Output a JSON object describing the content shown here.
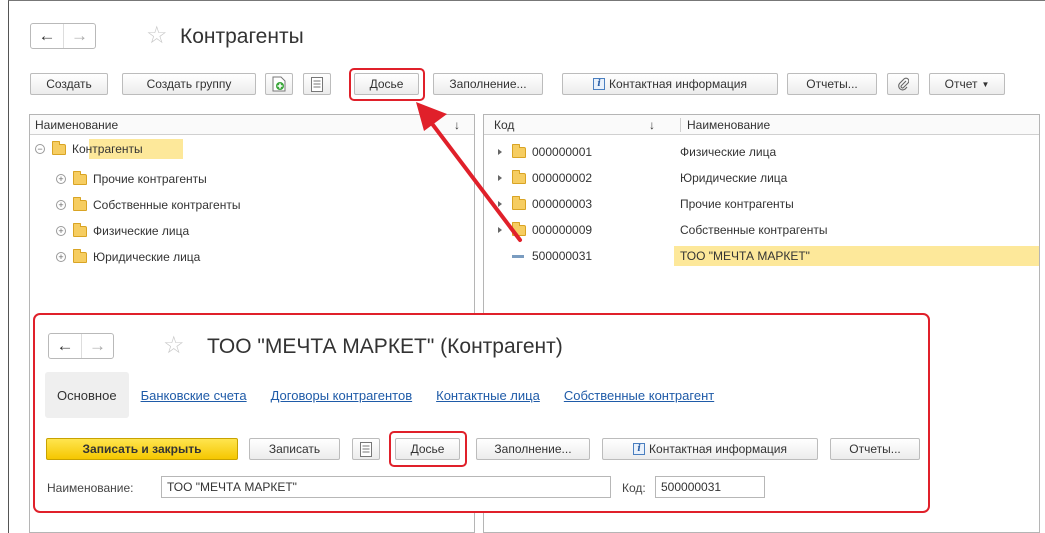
{
  "main": {
    "title": "Контрагенты",
    "toolbar": {
      "create": "Создать",
      "create_group": "Создать группу",
      "dossier": "Досье",
      "fill": "Заполнение...",
      "contact_info": "Контактная информация",
      "reports": "Отчеты...",
      "report": "Отчет"
    },
    "tree": {
      "column": "Наименование",
      "root": "Контрагенты",
      "items": [
        "Прочие контрагенты",
        "Собственные контрагенты",
        "Физические лица",
        "Юридические лица"
      ]
    },
    "list": {
      "col_code": "Код",
      "col_name": "Наименование",
      "rows": [
        {
          "code": "000000001",
          "name": "Физические лица",
          "type": "folder"
        },
        {
          "code": "000000002",
          "name": "Юридические лица",
          "type": "folder"
        },
        {
          "code": "000000003",
          "name": "Прочие контрагенты",
          "type": "folder"
        },
        {
          "code": "000000009",
          "name": "Собственные контрагенты",
          "type": "folder"
        },
        {
          "code": "500000031",
          "name": "ТОО \"МЕЧТА МАРКЕТ\"",
          "type": "item"
        }
      ]
    }
  },
  "sub": {
    "title": "ТОО \"МЕЧТА МАРКЕТ\" (Контрагент)",
    "tabs": [
      "Основное",
      "Банковские счета",
      "Договоры контрагентов",
      "Контактные лица",
      "Собственные контрагент"
    ],
    "toolbar": {
      "save_close": "Записать и закрыть",
      "save": "Записать",
      "dossier": "Досье",
      "fill": "Заполнение...",
      "contact_info": "Контактная информация",
      "reports": "Отчеты..."
    },
    "name_label": "Наименование:",
    "name_value": "ТОО \"МЕЧТА МАРКЕТ\"",
    "code_label": "Код:",
    "code_value": "500000031"
  },
  "colors": {
    "highlight": "#e0202a",
    "selection": "#fde89a",
    "link": "#1f5ba8",
    "primary": "#f5c700"
  }
}
